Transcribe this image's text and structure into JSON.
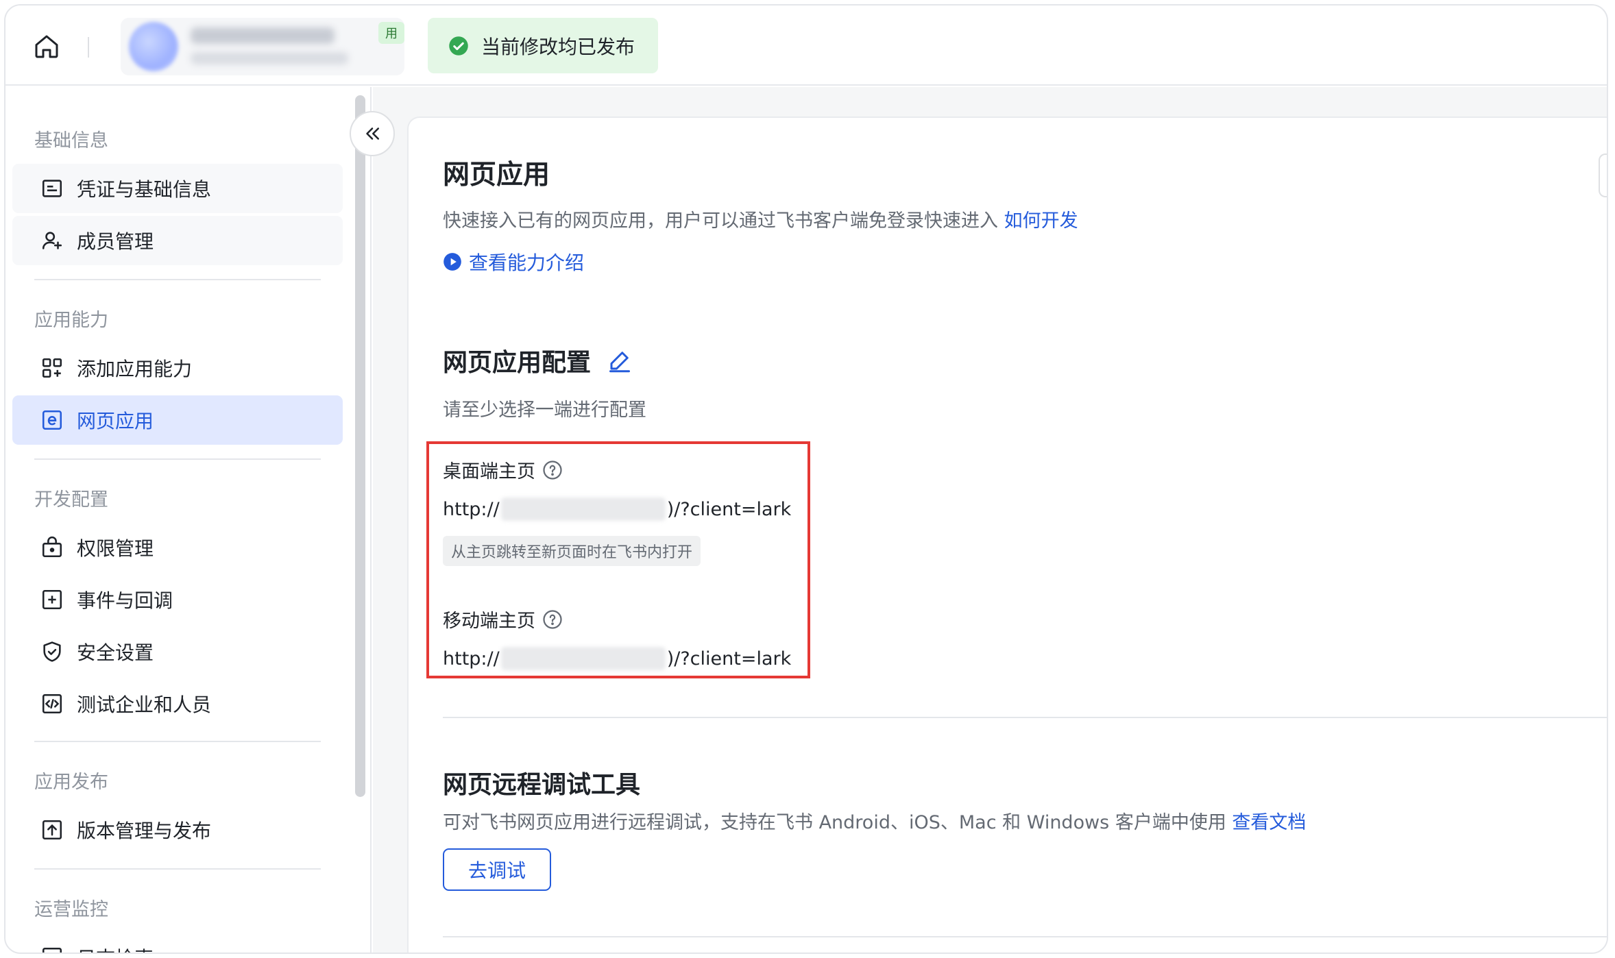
{
  "topbar": {
    "app_tag": "用",
    "publish_status": "当前修改均已发布",
    "icons": {
      "home": "home-icon",
      "status": "check-circle-icon"
    }
  },
  "sidebar": {
    "groups": [
      {
        "title": "基础信息",
        "items": [
          {
            "label": "凭证与基础信息",
            "icon": "credential-icon"
          },
          {
            "label": "成员管理",
            "icon": "user-add-icon"
          }
        ]
      },
      {
        "title": "应用能力",
        "items": [
          {
            "label": "添加应用能力",
            "icon": "grid-add-icon"
          },
          {
            "label": "网页应用",
            "icon": "web-app-icon",
            "active": true
          }
        ]
      },
      {
        "title": "开发配置",
        "items": [
          {
            "label": "权限管理",
            "icon": "lock-icon"
          },
          {
            "label": "事件与回调",
            "icon": "plus-square-icon"
          },
          {
            "label": "安全设置",
            "icon": "shield-icon"
          },
          {
            "label": "测试企业和人员",
            "icon": "code-icon"
          }
        ]
      },
      {
        "title": "应用发布",
        "items": [
          {
            "label": "版本管理与发布",
            "icon": "upload-icon"
          }
        ]
      },
      {
        "title": "运营监控",
        "items": [
          {
            "label": "日志检索",
            "icon": "log-icon"
          }
        ]
      }
    ]
  },
  "main": {
    "title": "网页应用",
    "description": "快速接入已有的网页应用，用户可以通过飞书客户端免登录快速进入",
    "how_to_link": "如何开发",
    "intro_link": "查看能力介绍",
    "config": {
      "title": "网页应用配置",
      "subtitle": "请至少选择一端进行配置",
      "desktop_label": "桌面端主页",
      "desktop_url_prefix": "http://",
      "desktop_url_suffix": ")/?client=lark",
      "desktop_tag": "从主页跳转至新页面时在飞书内打开",
      "mobile_label": "移动端主页",
      "mobile_url_prefix": "http://",
      "mobile_url_suffix": ")/?client=lark"
    },
    "debug": {
      "title": "网页远程调试工具",
      "description": "可对飞书网页应用进行远程调试，支持在飞书 Android、iOS、Mac 和 Windows 客户端中使用",
      "doc_link": "查看文档",
      "button": "去调试"
    }
  },
  "colors": {
    "accent": "#245bdb",
    "active_bg": "#e1e8ff",
    "success": "#34a853",
    "highlight": "#e53935"
  }
}
